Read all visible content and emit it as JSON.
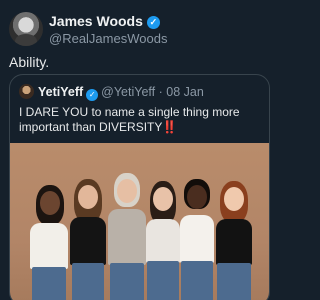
{
  "author": {
    "name": "James Woods",
    "handle": "@RealJamesWoods",
    "avatar_icon": "profile-photo"
  },
  "tweet_text": "Ability.",
  "quote": {
    "name": "YetiYeff",
    "handle": "@YetiYeff",
    "separator": "·",
    "date": "08 Jan",
    "text": "I DARE YOU to name a single thing more important than DIVERSITY",
    "emoji": "‼️",
    "image_icon": "group-photo"
  },
  "colors": {
    "background": "#15202b",
    "verified": "#1d9bf0",
    "secondary_text": "#8b98a5",
    "border": "#38444d"
  }
}
